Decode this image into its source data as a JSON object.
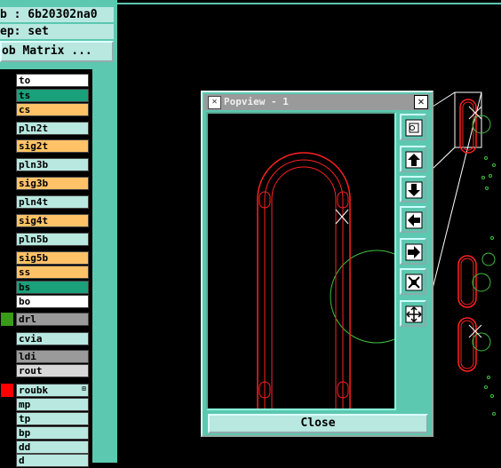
{
  "header": {
    "job_line": "b : 6b20302na0",
    "step_line": "ep: set",
    "job_matrix_label": "ob Matrix ..."
  },
  "layers": [
    {
      "name": "to",
      "color": "#ffffff",
      "swatch": ""
    },
    {
      "name": "ts",
      "color": "#1aa07a",
      "swatch": ""
    },
    {
      "name": "cs",
      "color": "#ffc266",
      "swatch": ""
    },
    {
      "name": "pln2t",
      "color": "#b8e8e0",
      "swatch": ""
    },
    {
      "name": "sig2t",
      "color": "#ffc266",
      "swatch": ""
    },
    {
      "name": "pln3b",
      "color": "#b8e8e0",
      "swatch": ""
    },
    {
      "name": "sig3b",
      "color": "#ffc266",
      "swatch": ""
    },
    {
      "name": "pln4t",
      "color": "#b8e8e0",
      "swatch": ""
    },
    {
      "name": "sig4t",
      "color": "#ffc266",
      "swatch": ""
    },
    {
      "name": "pln5b",
      "color": "#b8e8e0",
      "swatch": ""
    },
    {
      "name": "sig5b",
      "color": "#ffc266",
      "swatch": ""
    },
    {
      "name": "ss",
      "color": "#ffc266",
      "swatch": ""
    },
    {
      "name": "bs",
      "color": "#1aa07a",
      "swatch": ""
    },
    {
      "name": "bo",
      "color": "#ffffff",
      "swatch": ""
    },
    {
      "name": "drl",
      "color": "#9a9a9a",
      "swatch": "#3a9a1a"
    },
    {
      "name": "cvia",
      "color": "#b8e8e0",
      "swatch": ""
    },
    {
      "name": "ldi",
      "color": "#9a9a9a",
      "swatch": ""
    },
    {
      "name": "rout",
      "color": "#d8d8d8",
      "swatch": ""
    },
    {
      "name": "roubk",
      "color": "#b8e8e0",
      "swatch": "#ff0000"
    },
    {
      "name": "mp",
      "color": "#b8e8e0",
      "swatch": ""
    },
    {
      "name": "tp",
      "color": "#b8e8e0",
      "swatch": ""
    },
    {
      "name": "bp",
      "color": "#b8e8e0",
      "swatch": ""
    },
    {
      "name": "dd",
      "color": "#b8e8e0",
      "swatch": ""
    },
    {
      "name": "d",
      "color": "#b8e8e0",
      "swatch": ""
    }
  ],
  "popview": {
    "title": "Popview - 1",
    "close_label": "Close",
    "tools": [
      "zoom-fit-icon",
      "move-up-icon",
      "move-down-icon",
      "move-left-icon",
      "move-right-icon",
      "zoom-in-icon",
      "zoom-out-icon"
    ]
  },
  "colors": {
    "panel": "#5cc8b0",
    "outline_red": "#ff2020",
    "outline_green": "#40c040",
    "cursor": "#ffffff"
  }
}
